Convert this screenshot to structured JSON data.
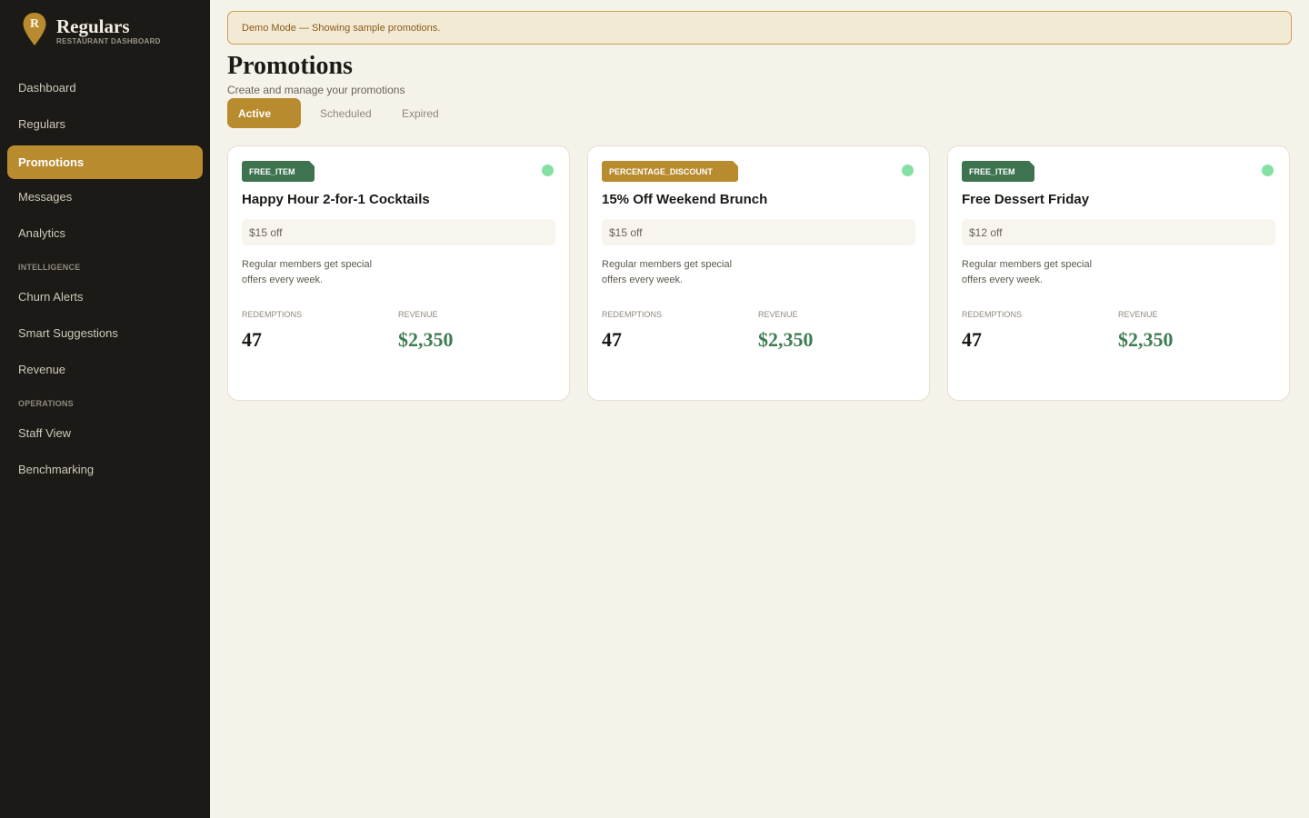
{
  "brand": {
    "initial": "R",
    "name": "Regulars",
    "subtitle": "RESTAURANT DASHBOARD"
  },
  "sidebar": {
    "items": [
      {
        "label": "Dashboard"
      },
      {
        "label": "Regulars"
      },
      {
        "label": "Promotions",
        "active": true
      },
      {
        "label": "Messages"
      },
      {
        "label": "Analytics"
      }
    ],
    "section_intelligence": "INTELLIGENCE",
    "intelligence_items": [
      {
        "label": "Churn Alerts"
      },
      {
        "label": "Smart Suggestions"
      },
      {
        "label": "Revenue"
      }
    ],
    "section_operations": "OPERATIONS",
    "operations_items": [
      {
        "label": "Staff View"
      },
      {
        "label": "Benchmarking"
      }
    ]
  },
  "banner": {
    "text": "Demo Mode — Showing sample promotions."
  },
  "page": {
    "title": "Promotions",
    "subtitle": "Create and manage your promotions"
  },
  "tabs": [
    {
      "label": "Active",
      "active": true
    },
    {
      "label": "Scheduled"
    },
    {
      "label": "Expired"
    }
  ],
  "cards": [
    {
      "type": "FREE_ITEM",
      "title": "Happy Hour 2-for-1 Cocktails",
      "offer": "$15 off",
      "description": "Regular members get special offers every week.",
      "redemptions_label": "REDEMPTIONS",
      "redemptions": "47",
      "revenue_label": "REVENUE",
      "revenue": "$2,350"
    },
    {
      "type": "PERCENTAGE_DISCOUNT",
      "title": "15% Off Weekend Brunch",
      "offer": "$15 off",
      "description": "Regular members get special offers every week.",
      "redemptions_label": "REDEMPTIONS",
      "redemptions": "47",
      "revenue_label": "REVENUE",
      "revenue": "$2,350"
    },
    {
      "type": "FREE_ITEM",
      "title": "Free Dessert Friday",
      "offer": "$12 off",
      "description": "Regular members get special offers every week.",
      "redemptions_label": "REDEMPTIONS",
      "redemptions": "47",
      "revenue_label": "REVENUE",
      "revenue": "$2,350"
    }
  ],
  "colors": {
    "sidebar_bg": "#1c1a16",
    "accent_gold": "#b98b2f",
    "badge_green": "#3e7350",
    "revenue_green": "#3e7d52",
    "status_active": "#86e0a4",
    "page_bg": "#f5f2ea"
  }
}
